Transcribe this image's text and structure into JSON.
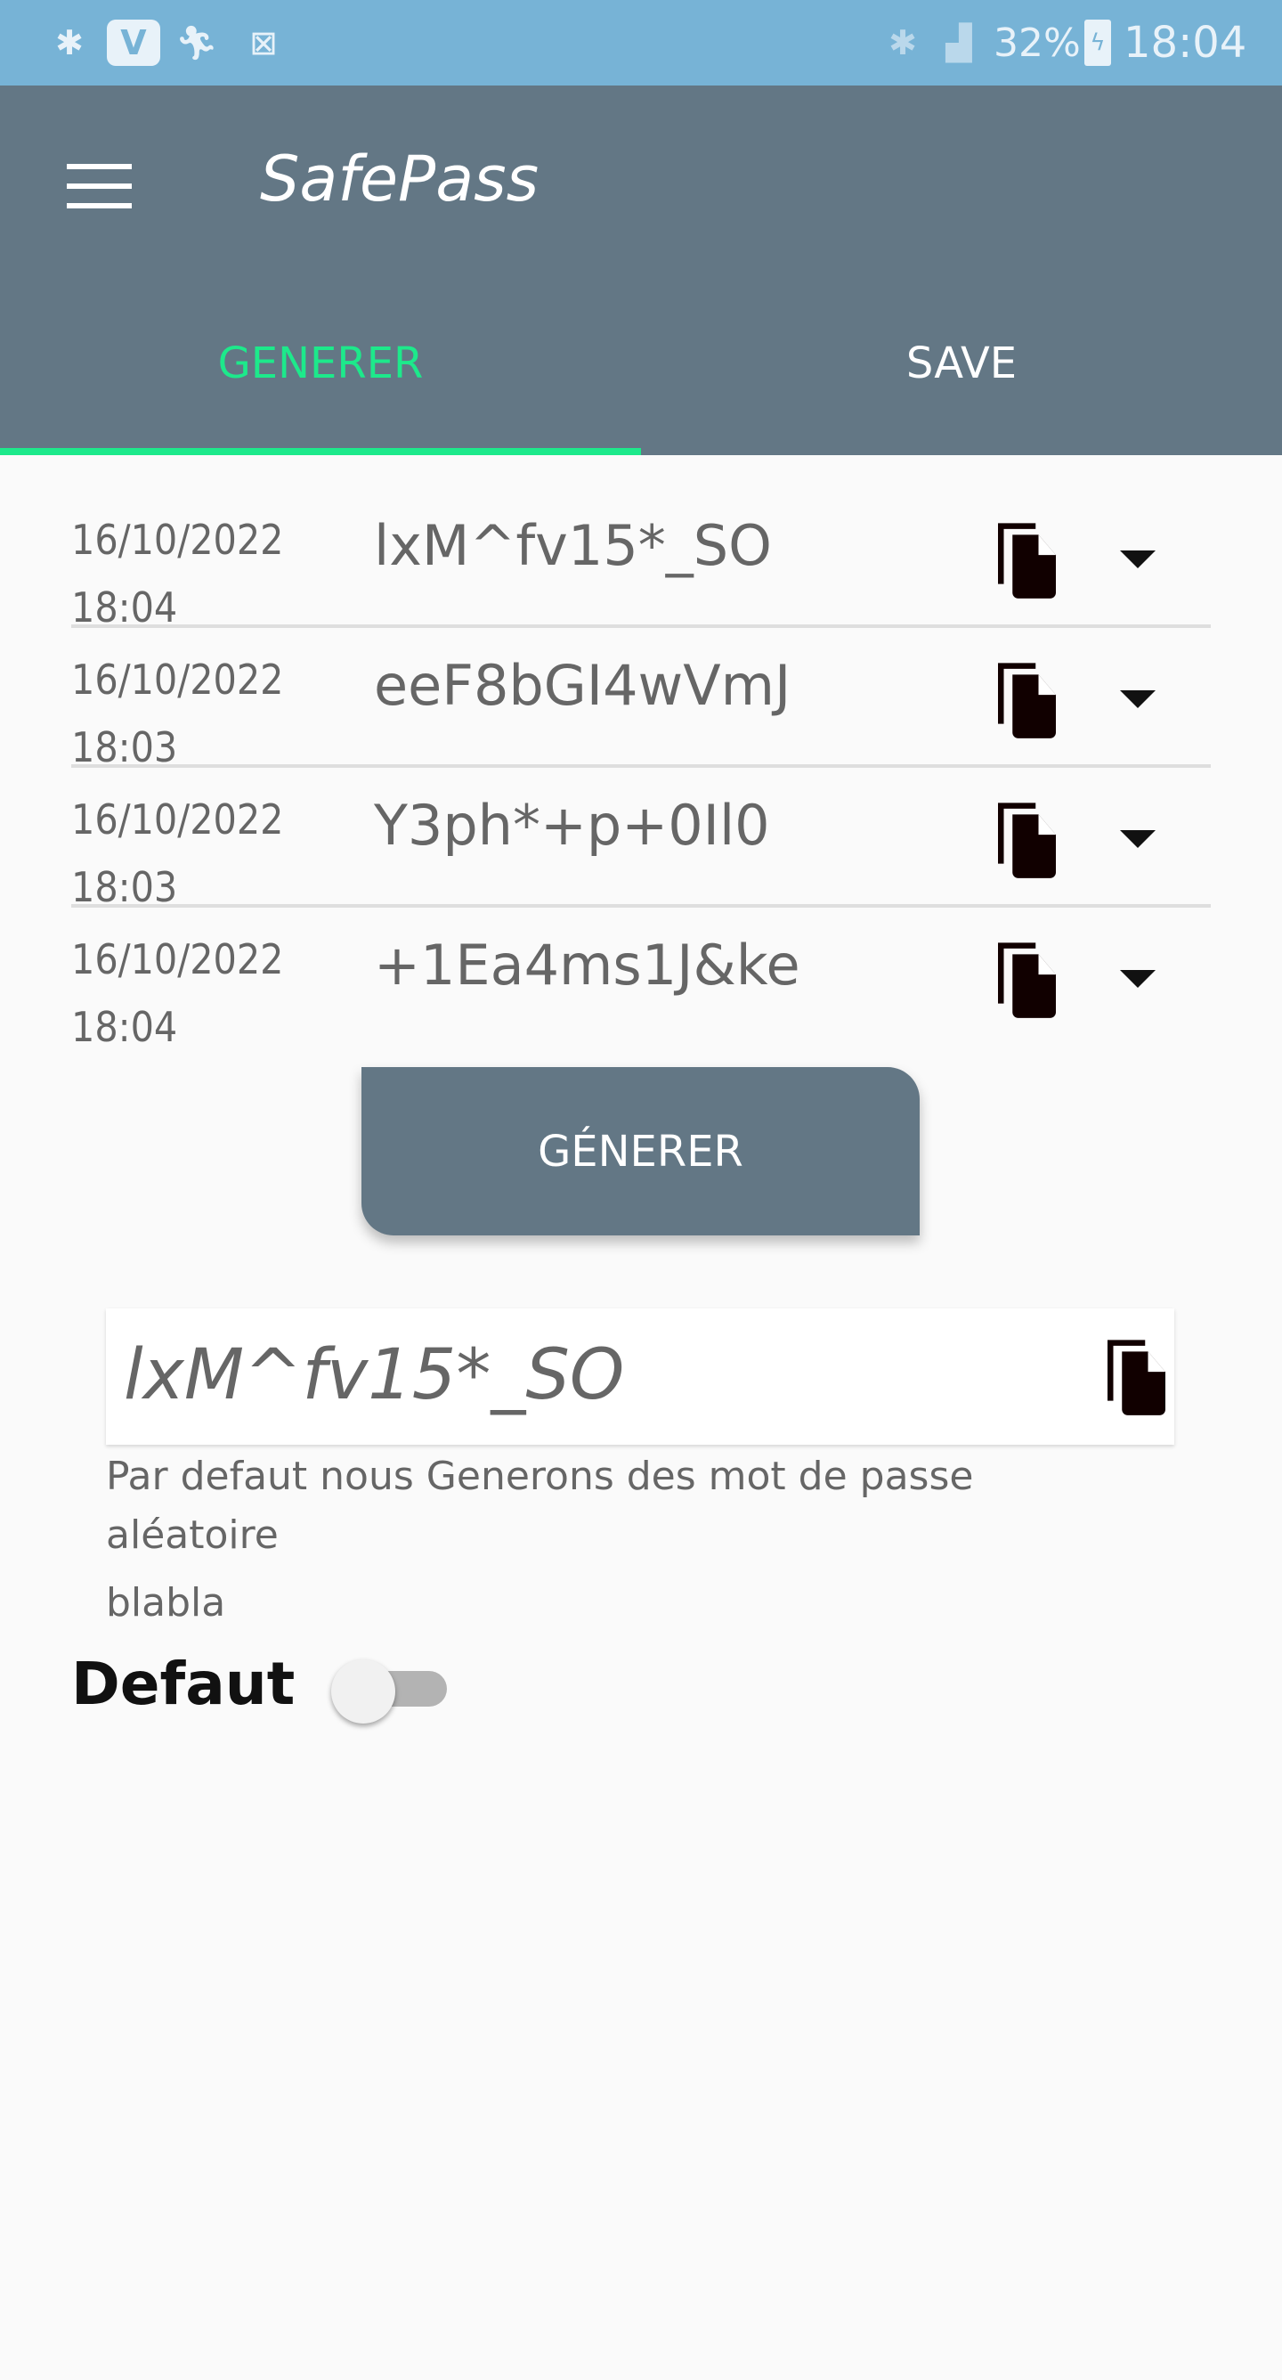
{
  "status_bar": {
    "battery": "32%",
    "time": "18:04",
    "icons": [
      "bluetooth-icon",
      "v-app-icon",
      "fitness-icon",
      "sim-icon",
      "bluetooth-icon",
      "signal-icon",
      "battery-charging-icon"
    ]
  },
  "app_bar": {
    "title": "SafePass",
    "menu_icon": "hamburger-icon"
  },
  "tabs": [
    {
      "label": "GENERER",
      "active": true
    },
    {
      "label": "SAVE",
      "active": false
    }
  ],
  "accent_color": "#1de98b",
  "history": [
    {
      "date": "16/10/2022",
      "time": "18:04",
      "password": "lxM^fv15*_SO"
    },
    {
      "date": "16/10/2022",
      "time": "18:03",
      "password": "eeF8bGI4wVmJ"
    },
    {
      "date": "16/10/2022",
      "time": "18:03",
      "password": "Y3ph*+p+0Il0"
    },
    {
      "date": "16/10/2022",
      "time": "18:04",
      "password": "+1Ea4ms1J&ke"
    }
  ],
  "generate_button": "GÉNERER",
  "generated_password": "lxM^fv15*_SO",
  "help_text": {
    "line1": "Par defaut nous Generons des mot de passe",
    "line2": "aléatoire",
    "line3": "blabla"
  },
  "default_toggle": {
    "label": "Defaut",
    "on": false
  }
}
